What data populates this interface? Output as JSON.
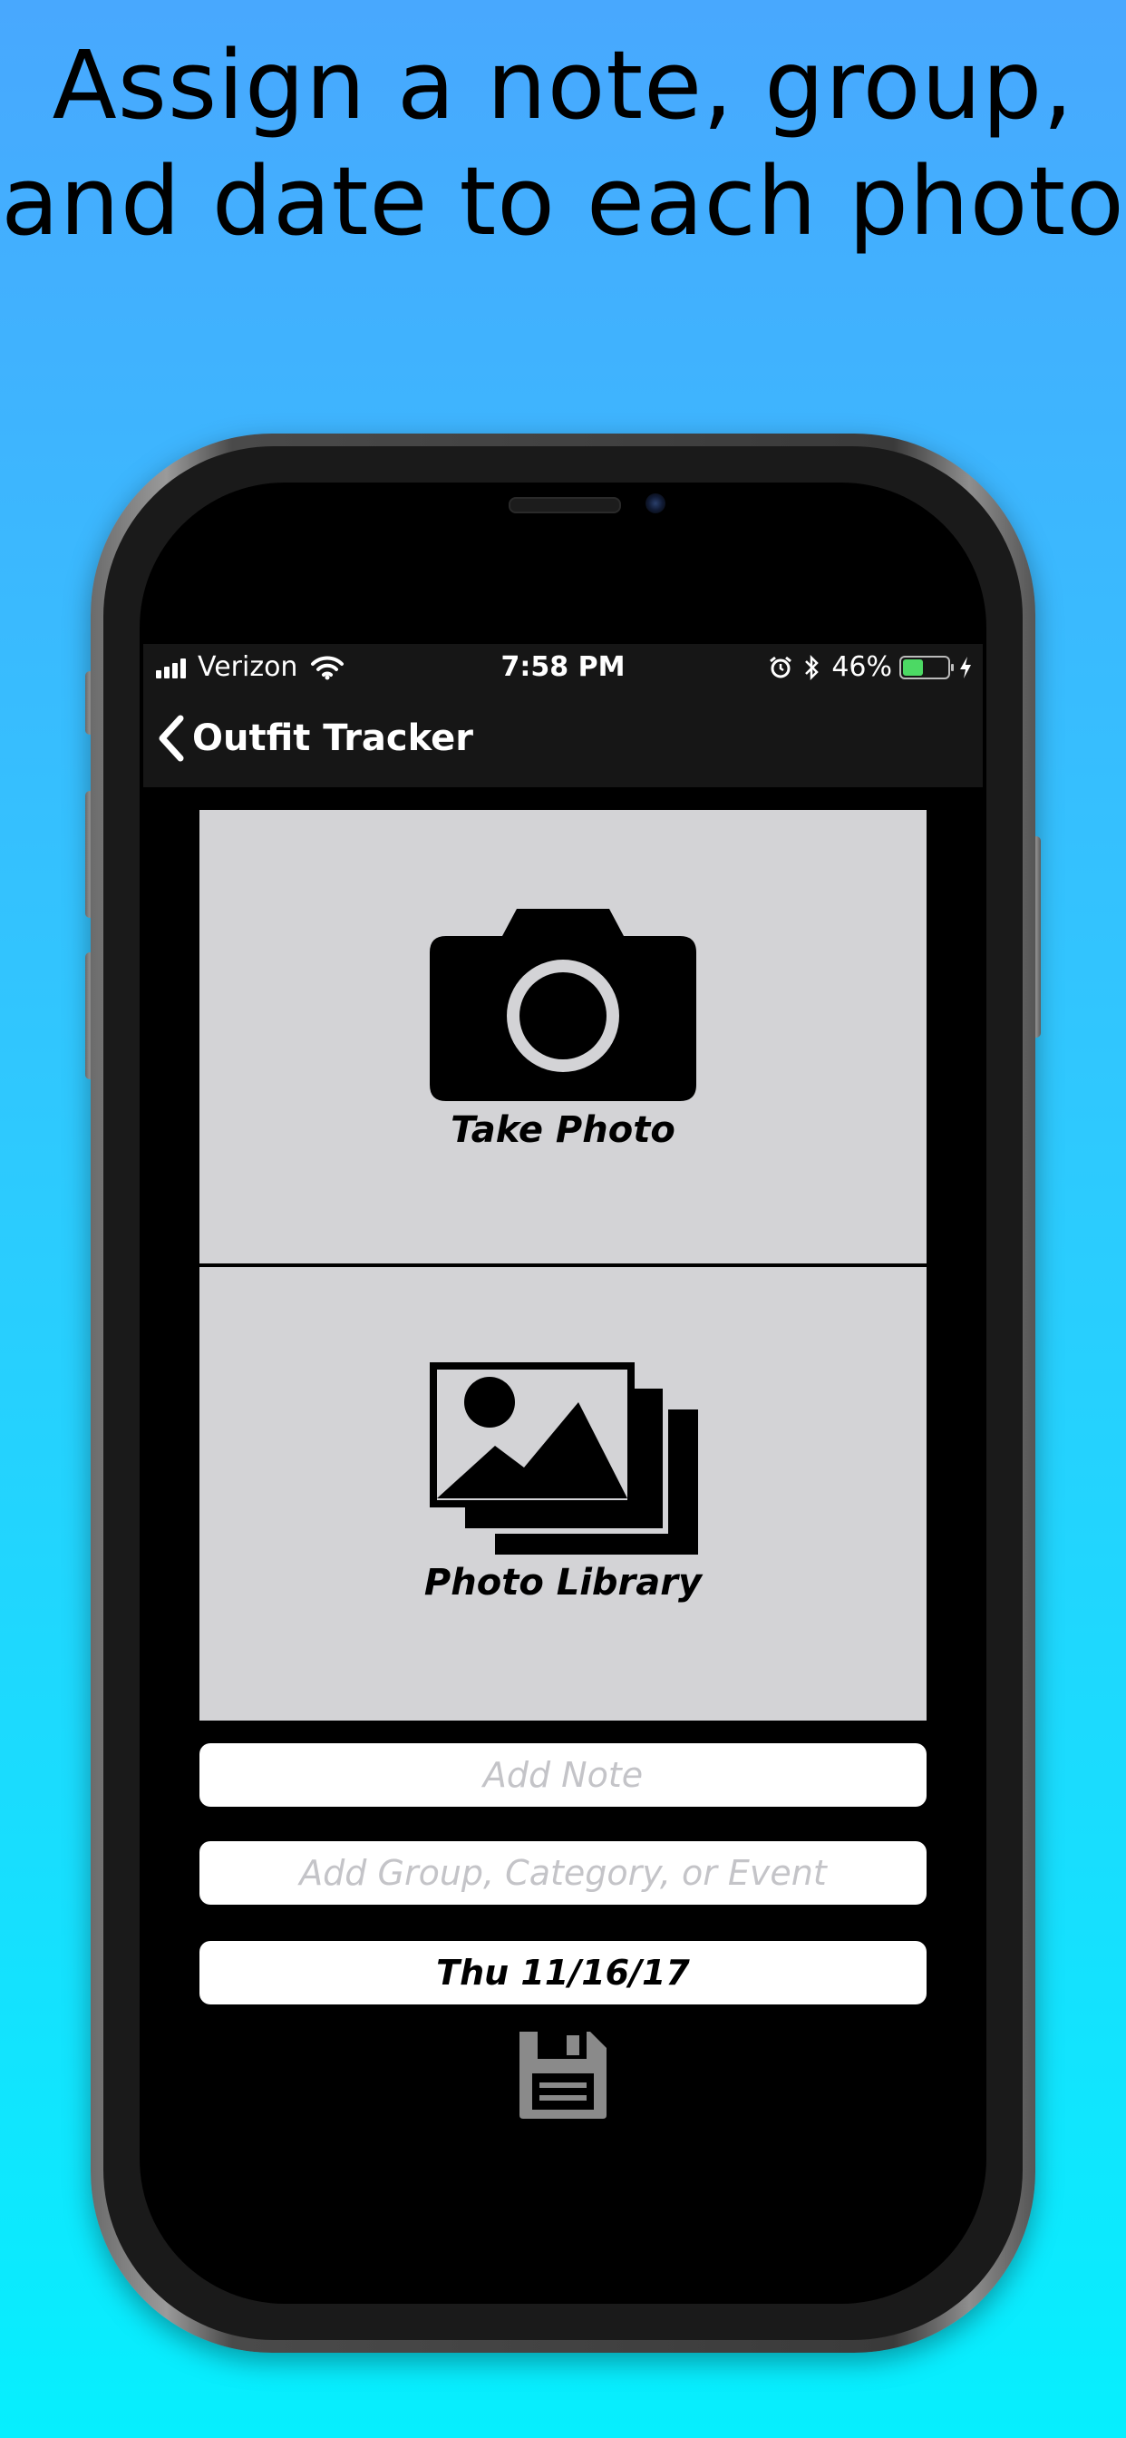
{
  "headline": {
    "line1": "Assign a note, group,",
    "line2": "and date to each photo"
  },
  "status_bar": {
    "carrier": "Verizon",
    "time": "7:58 PM",
    "battery_percent": "46%",
    "battery_level": 0.46,
    "icons": [
      "signal-bars-icon",
      "wifi-icon",
      "alarm-icon",
      "bluetooth-icon",
      "battery-icon",
      "charging-bolt-icon"
    ]
  },
  "nav": {
    "back_title": "Outfit Tracker",
    "back_icon": "chevron-left-icon"
  },
  "take_photo": {
    "label": "Take Photo",
    "icon": "camera-icon"
  },
  "photo_library": {
    "label": "Photo Library",
    "icon": "photo-stack-icon"
  },
  "fields": {
    "note_placeholder": "Add Note",
    "group_placeholder": "Add Group, Category, or Event",
    "date_value": "Thu  11/16/17"
  },
  "save": {
    "icon": "floppy-disk-icon"
  },
  "colors": {
    "bg_top": "#48a8fe",
    "bg_bottom": "#06effe",
    "panel": "#d3d3d6",
    "nav_bg": "#161616",
    "placeholder": "#c4c4c8",
    "battery_green": "#4cd964",
    "save_icon": "#8a8a8a"
  }
}
